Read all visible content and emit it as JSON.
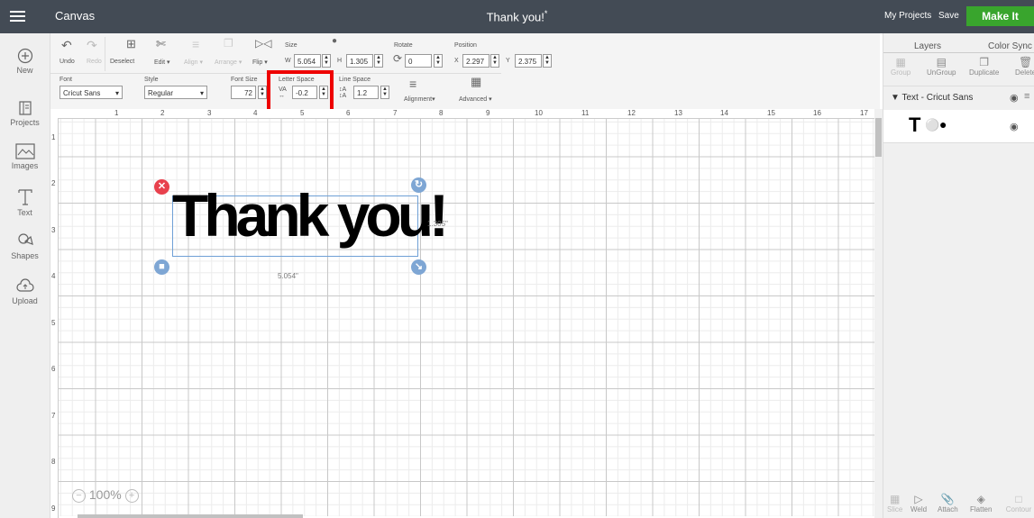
{
  "header": {
    "app_title": "Canvas",
    "doc_title": "Thank you!",
    "unsaved_marker": "*",
    "my_projects": "My Projects",
    "save": "Save",
    "make_it": "Make It"
  },
  "sidebar": {
    "items": [
      {
        "label": "New",
        "icon": "plus-circle"
      },
      {
        "label": "Projects",
        "icon": "book"
      },
      {
        "label": "Images",
        "icon": "image"
      },
      {
        "label": "Text",
        "icon": "text-t"
      },
      {
        "label": "Shapes",
        "icon": "shapes"
      },
      {
        "label": "Upload",
        "icon": "upload-cloud"
      }
    ]
  },
  "toolbar": {
    "undo": "Undo",
    "redo": "Redo",
    "deselect": "Deselect",
    "edit": "Edit",
    "align": "Align",
    "arrange": "Arrange",
    "flip": "Flip",
    "size_label": "Size",
    "w_label": "W",
    "w_value": "5.054",
    "h_label": "H",
    "h_value": "1.305",
    "rotate_label": "Rotate",
    "rotate_value": "0",
    "position_label": "Position",
    "x_label": "X",
    "x_value": "2.297",
    "y_label": "Y",
    "y_value": "2.375",
    "font_label": "Font",
    "font_value": "Cricut Sans",
    "style_label": "Style",
    "style_value": "Regular",
    "fontsize_label": "Font Size",
    "fontsize_value": "72",
    "letterspace_label": "Letter Space",
    "letterspace_value": "-0.2",
    "linespace_label": "Line Space",
    "linespace_value": "1.2",
    "alignment": "Alignment",
    "advanced": "Advanced"
  },
  "rulers": {
    "top": [
      "1",
      "2",
      "3",
      "4",
      "5",
      "6",
      "7",
      "8",
      "9",
      "10",
      "11",
      "12",
      "13",
      "14",
      "15",
      "16",
      "17"
    ],
    "left": [
      "1",
      "2",
      "3",
      "4",
      "5",
      "6",
      "7",
      "8",
      "9"
    ]
  },
  "canvas": {
    "text": "Thank you!",
    "height_dim": "1.305\"",
    "width_dim": "5.054\"",
    "zoom": "100%"
  },
  "layers": {
    "tab_layers": "Layers",
    "tab_color_sync": "Color Sync",
    "group": "Group",
    "ungroup": "UnGroup",
    "duplicate": "Duplicate",
    "delete": "Delete",
    "layer_name": "Text - Cricut Sans",
    "slice": "Slice",
    "weld": "Weld",
    "attach": "Attach",
    "flatten": "Flatten",
    "contour": "Contour"
  },
  "colors": {
    "header": "#434b55",
    "make_it": "#39a52d",
    "highlight": "#e00000",
    "delete_handle": "#e8414d",
    "handle": "#7ea6d4"
  }
}
